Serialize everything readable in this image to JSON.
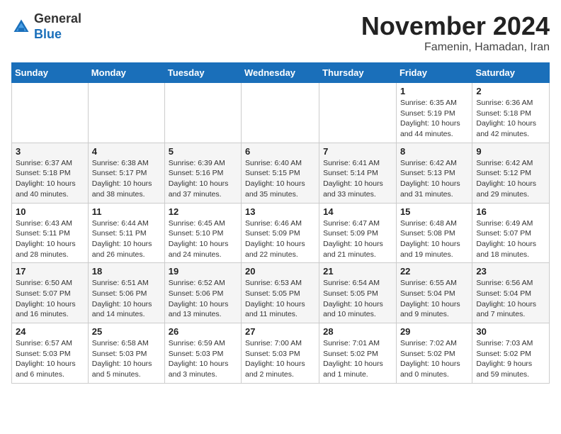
{
  "logo": {
    "line1": "General",
    "line2": "Blue"
  },
  "title": "November 2024",
  "location": "Famenin, Hamadan, Iran",
  "weekdays": [
    "Sunday",
    "Monday",
    "Tuesday",
    "Wednesday",
    "Thursday",
    "Friday",
    "Saturday"
  ],
  "weeks": [
    [
      {
        "day": "",
        "info": ""
      },
      {
        "day": "",
        "info": ""
      },
      {
        "day": "",
        "info": ""
      },
      {
        "day": "",
        "info": ""
      },
      {
        "day": "",
        "info": ""
      },
      {
        "day": "1",
        "info": "Sunrise: 6:35 AM\nSunset: 5:19 PM\nDaylight: 10 hours\nand 44 minutes."
      },
      {
        "day": "2",
        "info": "Sunrise: 6:36 AM\nSunset: 5:18 PM\nDaylight: 10 hours\nand 42 minutes."
      }
    ],
    [
      {
        "day": "3",
        "info": "Sunrise: 6:37 AM\nSunset: 5:18 PM\nDaylight: 10 hours\nand 40 minutes."
      },
      {
        "day": "4",
        "info": "Sunrise: 6:38 AM\nSunset: 5:17 PM\nDaylight: 10 hours\nand 38 minutes."
      },
      {
        "day": "5",
        "info": "Sunrise: 6:39 AM\nSunset: 5:16 PM\nDaylight: 10 hours\nand 37 minutes."
      },
      {
        "day": "6",
        "info": "Sunrise: 6:40 AM\nSunset: 5:15 PM\nDaylight: 10 hours\nand 35 minutes."
      },
      {
        "day": "7",
        "info": "Sunrise: 6:41 AM\nSunset: 5:14 PM\nDaylight: 10 hours\nand 33 minutes."
      },
      {
        "day": "8",
        "info": "Sunrise: 6:42 AM\nSunset: 5:13 PM\nDaylight: 10 hours\nand 31 minutes."
      },
      {
        "day": "9",
        "info": "Sunrise: 6:42 AM\nSunset: 5:12 PM\nDaylight: 10 hours\nand 29 minutes."
      }
    ],
    [
      {
        "day": "10",
        "info": "Sunrise: 6:43 AM\nSunset: 5:11 PM\nDaylight: 10 hours\nand 28 minutes."
      },
      {
        "day": "11",
        "info": "Sunrise: 6:44 AM\nSunset: 5:11 PM\nDaylight: 10 hours\nand 26 minutes."
      },
      {
        "day": "12",
        "info": "Sunrise: 6:45 AM\nSunset: 5:10 PM\nDaylight: 10 hours\nand 24 minutes."
      },
      {
        "day": "13",
        "info": "Sunrise: 6:46 AM\nSunset: 5:09 PM\nDaylight: 10 hours\nand 22 minutes."
      },
      {
        "day": "14",
        "info": "Sunrise: 6:47 AM\nSunset: 5:09 PM\nDaylight: 10 hours\nand 21 minutes."
      },
      {
        "day": "15",
        "info": "Sunrise: 6:48 AM\nSunset: 5:08 PM\nDaylight: 10 hours\nand 19 minutes."
      },
      {
        "day": "16",
        "info": "Sunrise: 6:49 AM\nSunset: 5:07 PM\nDaylight: 10 hours\nand 18 minutes."
      }
    ],
    [
      {
        "day": "17",
        "info": "Sunrise: 6:50 AM\nSunset: 5:07 PM\nDaylight: 10 hours\nand 16 minutes."
      },
      {
        "day": "18",
        "info": "Sunrise: 6:51 AM\nSunset: 5:06 PM\nDaylight: 10 hours\nand 14 minutes."
      },
      {
        "day": "19",
        "info": "Sunrise: 6:52 AM\nSunset: 5:06 PM\nDaylight: 10 hours\nand 13 minutes."
      },
      {
        "day": "20",
        "info": "Sunrise: 6:53 AM\nSunset: 5:05 PM\nDaylight: 10 hours\nand 11 minutes."
      },
      {
        "day": "21",
        "info": "Sunrise: 6:54 AM\nSunset: 5:05 PM\nDaylight: 10 hours\nand 10 minutes."
      },
      {
        "day": "22",
        "info": "Sunrise: 6:55 AM\nSunset: 5:04 PM\nDaylight: 10 hours\nand 9 minutes."
      },
      {
        "day": "23",
        "info": "Sunrise: 6:56 AM\nSunset: 5:04 PM\nDaylight: 10 hours\nand 7 minutes."
      }
    ],
    [
      {
        "day": "24",
        "info": "Sunrise: 6:57 AM\nSunset: 5:03 PM\nDaylight: 10 hours\nand 6 minutes."
      },
      {
        "day": "25",
        "info": "Sunrise: 6:58 AM\nSunset: 5:03 PM\nDaylight: 10 hours\nand 5 minutes."
      },
      {
        "day": "26",
        "info": "Sunrise: 6:59 AM\nSunset: 5:03 PM\nDaylight: 10 hours\nand 3 minutes."
      },
      {
        "day": "27",
        "info": "Sunrise: 7:00 AM\nSunset: 5:03 PM\nDaylight: 10 hours\nand 2 minutes."
      },
      {
        "day": "28",
        "info": "Sunrise: 7:01 AM\nSunset: 5:02 PM\nDaylight: 10 hours\nand 1 minute."
      },
      {
        "day": "29",
        "info": "Sunrise: 7:02 AM\nSunset: 5:02 PM\nDaylight: 10 hours\nand 0 minutes."
      },
      {
        "day": "30",
        "info": "Sunrise: 7:03 AM\nSunset: 5:02 PM\nDaylight: 9 hours\nand 59 minutes."
      }
    ]
  ]
}
